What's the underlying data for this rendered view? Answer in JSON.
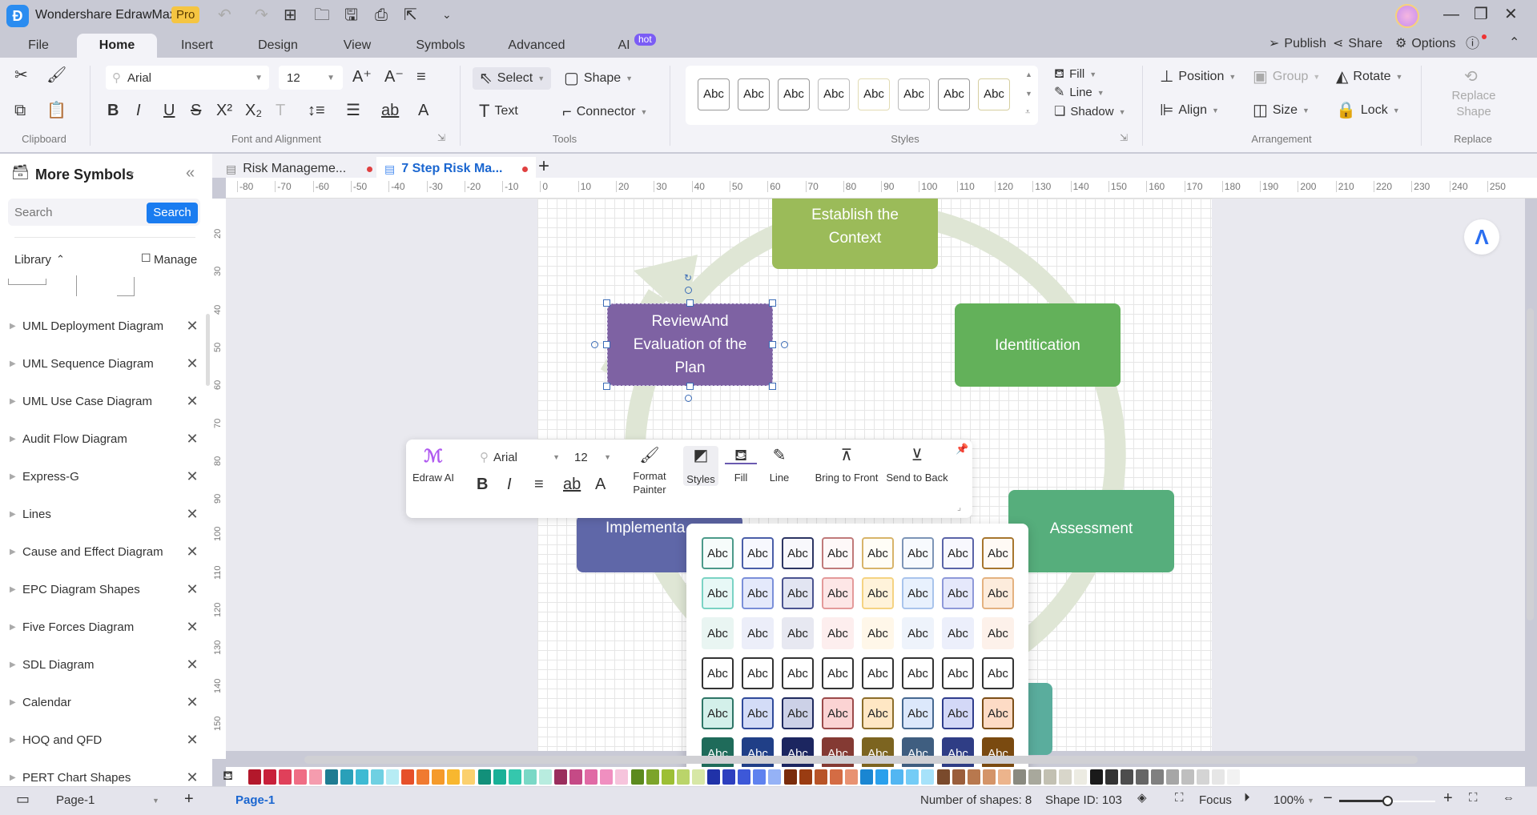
{
  "app": {
    "name": "Wondershare EdrawMax",
    "badge": "Pro"
  },
  "menu_tabs": [
    {
      "label": "File"
    },
    {
      "label": "Home",
      "active": true
    },
    {
      "label": "Insert"
    },
    {
      "label": "Design"
    },
    {
      "label": "View"
    },
    {
      "label": "Symbols"
    },
    {
      "label": "Advanced"
    },
    {
      "label": "AI",
      "badge": "hot"
    }
  ],
  "top_actions": {
    "publish": "Publish",
    "share": "Share",
    "options": "Options"
  },
  "ribbon": {
    "font_family": "Arial",
    "font_size": "12",
    "select": "Select",
    "shape": "Shape",
    "text": "Text",
    "connector": "Connector",
    "fill": "Fill",
    "line": "Line",
    "shadow": "Shadow",
    "position": "Position",
    "group": "Group",
    "rotate": "Rotate",
    "align": "Align",
    "size": "Size",
    "lock": "Lock",
    "replace_shape": "Replace Shape",
    "style_sample": "Abc",
    "group_labels": {
      "clipboard": "Clipboard",
      "font": "Font and Alignment",
      "tools": "Tools",
      "styles": "Styles",
      "arrangement": "Arrangement",
      "replace": "Replace"
    }
  },
  "sidebar": {
    "title": "More Symbols",
    "search_placeholder": "Search",
    "search_button": "Search",
    "library_label": "Library",
    "manage_label": "Manage",
    "libraries": [
      "UML Deployment Diagram",
      "UML Sequence Diagram",
      "UML Use Case Diagram",
      "Audit Flow Diagram",
      "Express-G",
      "Lines",
      "Cause and Effect Diagram",
      "EPC Diagram Shapes",
      "Five Forces Diagram",
      "SDL Diagram",
      "Calendar",
      "HOQ and QFD",
      "PERT Chart Shapes"
    ]
  },
  "doc_tabs": [
    {
      "label": "Risk Manageme...",
      "active": false
    },
    {
      "label": "7 Step Risk Ma...",
      "active": true
    }
  ],
  "ruler": {
    "h_ticks": [
      "-80",
      "-70",
      "-60",
      "-50",
      "-40",
      "-30",
      "-20",
      "-10",
      "0",
      "10",
      "20",
      "30",
      "40",
      "50",
      "60",
      "70",
      "80",
      "90",
      "100",
      "110",
      "120",
      "130",
      "140",
      "150",
      "160",
      "170",
      "180",
      "190",
      "200",
      "210",
      "220",
      "230",
      "240",
      "250"
    ],
    "v_ticks": [
      "20",
      "30",
      "40",
      "50",
      "60",
      "70",
      "80",
      "90",
      "100",
      "110",
      "120",
      "130",
      "140",
      "150"
    ]
  },
  "diagram": {
    "nodes": [
      {
        "id": "establish",
        "text": "Establish the Context",
        "color": "#9bbb59"
      },
      {
        "id": "identification",
        "text": "Identitication",
        "color": "#63b15a"
      },
      {
        "id": "assessment",
        "text": "Assessment",
        "color": "#56ae7c"
      },
      {
        "id": "review",
        "text": "ReviewAnd Evaluation of the Plan",
        "color": "#7e62a3"
      },
      {
        "id": "implementation",
        "text": "Implementa",
        "color": "#5f67a8"
      },
      {
        "id": "partial",
        "text": "",
        "color": "#5aad9d"
      }
    ]
  },
  "float_toolbar": {
    "edraw_ai": "Edraw AI",
    "font_family": "Arial",
    "font_size": "12",
    "format_painter": "Format Painter",
    "styles": "Styles",
    "fill": "Fill",
    "line": "Line",
    "bring_front": "Bring to Front",
    "send_back": "Send to Back"
  },
  "styles_popup": {
    "sample": "Abc",
    "rows": [
      {
        "kind": "outline-light",
        "fills": [
          "#f6fcfb",
          "#f7f8fe",
          "#f8f8fc",
          "#fef8f8",
          "#fffdf6",
          "#f7fafe",
          "#f8f8fe",
          "#fffaf5"
        ],
        "borders": [
          "#4c9a8a",
          "#4a5ea8",
          "#2c3563",
          "#c07a7a",
          "#d8b46a",
          "#7d95b7",
          "#5a64a8",
          "#a7762e"
        ],
        "text": "#222"
      },
      {
        "kind": "tinted",
        "fills": [
          "#e7f8f6",
          "#e4e9fb",
          "#e2e5f2",
          "#fde6e6",
          "#fff3da",
          "#e8f1fd",
          "#e5e8fb",
          "#fdecdc"
        ],
        "borders": [
          "#7bd3c4",
          "#7b8fd9",
          "#4a5390",
          "#e49a9a",
          "#f5d382",
          "#a9c4ec",
          "#8e99d9",
          "#e4b280"
        ],
        "text": "#222"
      },
      {
        "kind": "soft",
        "fills": [
          "#e9f5f2",
          "#eceef9",
          "#e7e8f1",
          "#fdeeee",
          "#fff7e9",
          "#eef3fb",
          "#eceffb",
          "#fdf1ea"
        ],
        "borders": [
          "transparent",
          "transparent",
          "transparent",
          "transparent",
          "transparent",
          "transparent",
          "transparent",
          "transparent"
        ],
        "text": "#222"
      },
      {
        "kind": "dark-outline",
        "fills": [
          "#fff",
          "#fff",
          "#fff",
          "#fff",
          "#fff",
          "#fff",
          "#fff",
          "#fff"
        ],
        "borders": [
          "#333",
          "#333",
          "#333",
          "#333",
          "#333",
          "#333",
          "#333",
          "#333"
        ],
        "text": "#222"
      },
      {
        "kind": "tinted-strong",
        "fills": [
          "#d3f0ea",
          "#d3dcf7",
          "#ccd1e7",
          "#fbd3d3",
          "#ffe7c4",
          "#dce8fb",
          "#d3d8f7",
          "#fddbc5"
        ],
        "borders": [
          "#2e7566",
          "#2f4a9a",
          "#1f2a5e",
          "#9b4a4a",
          "#8c6d2a",
          "#466890",
          "#2f3d8c",
          "#7b4e18"
        ],
        "text": "#222"
      },
      {
        "kind": "solid",
        "fills": [
          "#1f6b5a",
          "#203f87",
          "#1c2660",
          "#843a33",
          "#7c6420",
          "#3f5e80",
          "#2f3d85",
          "#7a4a10"
        ],
        "borders": [
          "#1f6b5a",
          "#203f87",
          "#1c2660",
          "#843a33",
          "#7c6420",
          "#3f5e80",
          "#2f3d85",
          "#7a4a10"
        ],
        "text": "#fff"
      }
    ]
  },
  "palette": [
    "#b3182b",
    "#c8203a",
    "#e0405a",
    "#ef6d84",
    "#f59cae",
    "#1f7c92",
    "#2aa0b9",
    "#3ebad3",
    "#6fd0e2",
    "#b6ecf4",
    "#e6502a",
    "#f07a30",
    "#f59a2a",
    "#f8b72f",
    "#fbd06e",
    "#12907a",
    "#19b097",
    "#35c7ad",
    "#7ad8c6",
    "#b8ecdf",
    "#9a2e5d",
    "#c54a86",
    "#e06aa5",
    "#f08fc0",
    "#f6c4dc",
    "#5c8a1e",
    "#7ca42a",
    "#9dbf35",
    "#bad46a",
    "#d7e7a6",
    "#2032a8",
    "#2d3fbf",
    "#3d58d8",
    "#5f82ef",
    "#95b2f6",
    "#7a2c0c",
    "#9a3c12",
    "#b85428",
    "#d46c44",
    "#e89272",
    "#1a86d2",
    "#2aa0ec",
    "#52b6f2",
    "#74ccf6",
    "#a6e2fa",
    "#7a4a2c",
    "#9a5e3c",
    "#b8784e",
    "#d49468",
    "#ecb48c",
    "#8a8a80",
    "#a8a89c",
    "#c2c0b2",
    "#d8d6ca",
    "#ecebe2",
    "#1a1a1a",
    "#333333",
    "#4d4d4d",
    "#666666",
    "#808080",
    "#a6a6a6",
    "#bfbfbf",
    "#d4d4d4",
    "#e6e6e6",
    "#f2f2f2"
  ],
  "status": {
    "page_select": "Page-1",
    "page_tab": "Page-1",
    "shape_count": "Number of shapes: 8",
    "shape_id": "Shape ID: 103",
    "focus": "Focus",
    "zoom": "100%",
    "zoom_fraction": 0.5
  }
}
